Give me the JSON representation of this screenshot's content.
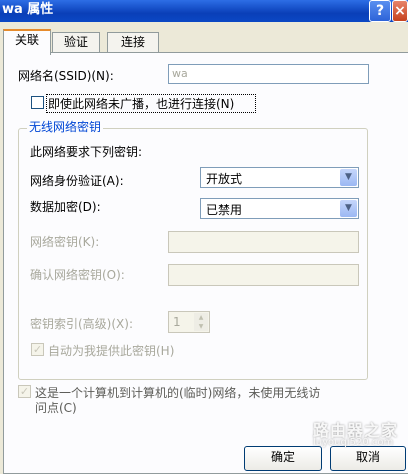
{
  "window": {
    "title": "wa 属性",
    "help_label": "?",
    "close_label": "×"
  },
  "tabs": [
    {
      "label": "关联",
      "active": true
    },
    {
      "label": "验证",
      "active": false
    },
    {
      "label": "连接",
      "active": false
    }
  ],
  "association": {
    "ssid_label": "网络名(SSID)(N):",
    "ssid_value": "wa",
    "hidden_checkbox_label": "即使此网络未广播，也进行连接(N)",
    "hidden_checked": false,
    "group_title": "无线网络密钥",
    "requires_key_text": "此网络要求下列密钥:",
    "auth_label": "网络身份验证(A):",
    "auth_value": "开放式",
    "encryption_label": "数据加密(D):",
    "encryption_value": "已禁用",
    "network_key_label": "网络密钥(K):",
    "network_key_value": "",
    "confirm_key_label": "确认网络密钥(O):",
    "confirm_key_value": "",
    "key_index_label": "密钥索引(高级)(X):",
    "key_index_value": "1",
    "auto_key_label": "自动为我提供此密钥(H)",
    "auto_key_checked": true,
    "adhoc_label_line1": "这是一个计算机到计算机的(临时)网络，未使用无线访",
    "adhoc_label_line2": "问点(C)",
    "adhoc_checked": true
  },
  "buttons": {
    "ok_label": "确定",
    "cancel_label": "取消"
  },
  "watermark": {
    "site_name": "路由器之家",
    "site_url": "luyouqi520.com"
  },
  "colors": {
    "titlebar": "#0a3fb8",
    "group_title": "#0046d5",
    "tab_highlight": "#e68b2c",
    "dialog_bg": "#ece9d8"
  }
}
